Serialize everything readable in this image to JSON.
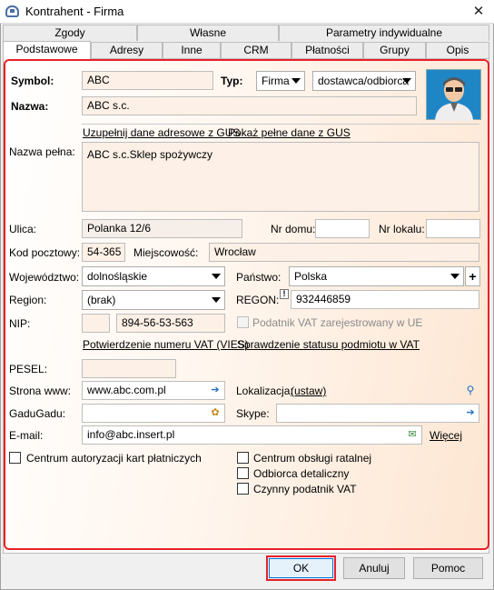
{
  "window": {
    "title": "Kontrahent - Firma"
  },
  "tabs_row1": [
    "Zgody",
    "Własne",
    "Parametry indywidualne"
  ],
  "tabs_row2": [
    "Podstawowe",
    "Adresy",
    "Inne",
    "CRM",
    "Płatności",
    "Grupy",
    "Opis"
  ],
  "form": {
    "symbol_label": "Symbol:",
    "symbol_value": "ABC",
    "typ_label": "Typ:",
    "typ_value": "Firma",
    "typ2_value": "dostawca/odbiorca",
    "nazwa_label": "Nazwa:",
    "nazwa_value": "ABC s.c.",
    "gus_fill_link": "Uzupełnij dane adresowe z GUS",
    "gus_show_link": "Pokaż pełne dane z GUS",
    "nazwa_pelna_label": "Nazwa pełna:",
    "nazwa_pelna_value": "ABC s.c.Sklep spożywczy",
    "ulica_label": "Ulica:",
    "ulica_value": "Polanka  12/6",
    "nr_domu_label": "Nr domu:",
    "nr_domu_value": "",
    "nr_lokalu_label": "Nr lokalu:",
    "nr_lokalu_value": "",
    "kod_label": "Kod pocztowy:",
    "kod_value": "54-365",
    "miejscowosc_label": "Miejscowość:",
    "miejscowosc_value": "Wrocław",
    "woj_label": "Województwo:",
    "woj_value": "dolnośląskie",
    "panstwo_label": "Państwo:",
    "panstwo_value": "Polska",
    "region_label": "Region:",
    "region_value": "(brak)",
    "regon_label": "REGON:",
    "regon_value": "932446859",
    "nip_label": "NIP:",
    "nip_prefix": "",
    "nip_value": "894-56-53-563",
    "vat_ue_label": "Podatnik VAT zarejestrowany w UE",
    "vies_link": "Potwierdzenie numeru VAT (VIES)",
    "vat_status_link": "Sprawdzenie statusu podmiotu w VAT",
    "pesel_label": "PESEL:",
    "pesel_value": "",
    "www_label": "Strona www:",
    "www_value": "www.abc.com.pl",
    "lokalizacja_label": "Lokalizacja:",
    "lokalizacja_link": "(ustaw)",
    "gadu_label": "GaduGadu:",
    "gadu_value": "",
    "skype_label": "Skype:",
    "skype_value": "",
    "email_label": "E-mail:",
    "email_value": "info@abc.insert.pl",
    "wiecej_link": "Więcej",
    "cb_centrum_kart": "Centrum autoryzacji kart płatniczych",
    "cb_centrum_ratalnej": "Centrum obsługi ratalnej",
    "cb_odbiorca": "Odbiorca detaliczny",
    "cb_czynny_vat": "Czynny podatnik VAT"
  },
  "buttons": {
    "ok": "OK",
    "cancel": "Anuluj",
    "help": "Pomoc"
  },
  "icons": {
    "app": "app-icon",
    "close": "close-icon",
    "avatar": "contact-avatar",
    "highlight_color": "#e8202a"
  }
}
